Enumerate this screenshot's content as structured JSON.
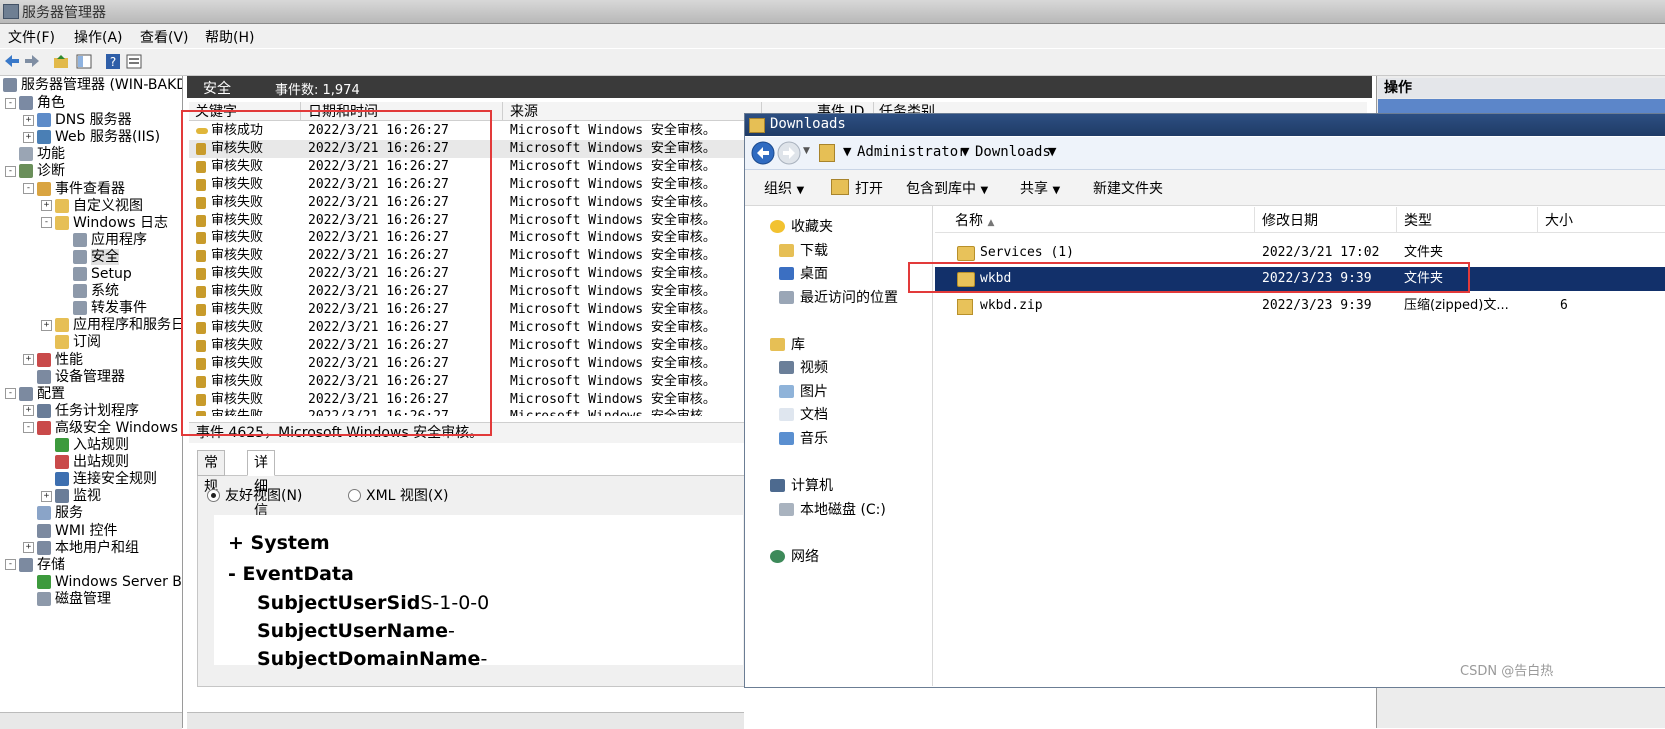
{
  "window": {
    "title": "服务器管理器"
  },
  "menu": [
    "文件(F)",
    "操作(A)",
    "查看(V)",
    "帮助(H)"
  ],
  "tree": {
    "root": "服务器管理器 (WIN-BAKD",
    "nodes": [
      {
        "label": "角色",
        "indent": 1
      },
      {
        "label": "DNS 服务器",
        "indent": 2
      },
      {
        "label": "Web 服务器(IIS)",
        "indent": 2
      },
      {
        "label": "功能",
        "indent": 1
      },
      {
        "label": "诊断",
        "indent": 1
      },
      {
        "label": "事件查看器",
        "indent": 2
      },
      {
        "label": "自定义视图",
        "indent": 3
      },
      {
        "label": "Windows 日志",
        "indent": 3
      },
      {
        "label": "应用程序",
        "indent": 4
      },
      {
        "label": "安全",
        "indent": 4
      },
      {
        "label": "Setup",
        "indent": 4
      },
      {
        "label": "系统",
        "indent": 4
      },
      {
        "label": "转发事件",
        "indent": 4
      },
      {
        "label": "应用程序和服务日",
        "indent": 3
      },
      {
        "label": "订阅",
        "indent": 3
      },
      {
        "label": "性能",
        "indent": 2
      },
      {
        "label": "设备管理器",
        "indent": 2
      },
      {
        "label": "配置",
        "indent": 1
      },
      {
        "label": "任务计划程序",
        "indent": 2
      },
      {
        "label": "高级安全 Windows",
        "indent": 2
      },
      {
        "label": "入站规则",
        "indent": 3
      },
      {
        "label": "出站规则",
        "indent": 3
      },
      {
        "label": "连接安全规则",
        "indent": 3
      },
      {
        "label": "监视",
        "indent": 3
      },
      {
        "label": "服务",
        "indent": 2
      },
      {
        "label": "WMI 控件",
        "indent": 2
      },
      {
        "label": "本地用户和组",
        "indent": 2
      },
      {
        "label": "存储",
        "indent": 1
      },
      {
        "label": "Windows Server Ba",
        "indent": 2
      },
      {
        "label": "磁盘管理",
        "indent": 2
      }
    ]
  },
  "log": {
    "name": "安全",
    "count_label": "事件数: 1,974",
    "columns": [
      "关键字",
      "日期和时间",
      "来源",
      "事件 ID",
      "任务类别"
    ],
    "rows": [
      {
        "keyword": "审核成功",
        "datetime": "2022/3/21 16:26:27",
        "source": "Microsoft Windows 安全审核。"
      },
      {
        "keyword": "审核失败",
        "datetime": "2022/3/21 16:26:27",
        "source": "Microsoft Windows 安全审核。"
      },
      {
        "keyword": "审核失败",
        "datetime": "2022/3/21 16:26:27",
        "source": "Microsoft Windows 安全审核。"
      },
      {
        "keyword": "审核失败",
        "datetime": "2022/3/21 16:26:27",
        "source": "Microsoft Windows 安全审核。"
      },
      {
        "keyword": "审核失败",
        "datetime": "2022/3/21 16:26:27",
        "source": "Microsoft Windows 安全审核。"
      },
      {
        "keyword": "审核失败",
        "datetime": "2022/3/21 16:26:27",
        "source": "Microsoft Windows 安全审核。"
      },
      {
        "keyword": "审核失败",
        "datetime": "2022/3/21 16:26:27",
        "source": "Microsoft Windows 安全审核。"
      },
      {
        "keyword": "审核失败",
        "datetime": "2022/3/21 16:26:27",
        "source": "Microsoft Windows 安全审核。"
      },
      {
        "keyword": "审核失败",
        "datetime": "2022/3/21 16:26:27",
        "source": "Microsoft Windows 安全审核。"
      },
      {
        "keyword": "审核失败",
        "datetime": "2022/3/21 16:26:27",
        "source": "Microsoft Windows 安全审核。"
      },
      {
        "keyword": "审核失败",
        "datetime": "2022/3/21 16:26:27",
        "source": "Microsoft Windows 安全审核。"
      },
      {
        "keyword": "审核失败",
        "datetime": "2022/3/21 16:26:27",
        "source": "Microsoft Windows 安全审核。"
      },
      {
        "keyword": "审核失败",
        "datetime": "2022/3/21 16:26:27",
        "source": "Microsoft Windows 安全审核。"
      },
      {
        "keyword": "审核失败",
        "datetime": "2022/3/21 16:26:27",
        "source": "Microsoft Windows 安全审核。"
      },
      {
        "keyword": "审核失败",
        "datetime": "2022/3/21 16:26:27",
        "source": "Microsoft Windows 安全审核。"
      },
      {
        "keyword": "审核失败",
        "datetime": "2022/3/21 16:26:27",
        "source": "Microsoft Windows 安全审核。"
      },
      {
        "keyword": "审核失败",
        "datetime": "2022/3/21 16:26:27",
        "source": "Microsoft Windows 安全审核。"
      }
    ],
    "status": "事件 4625，Microsoft Windows 安全审核。",
    "tabs": [
      "常规",
      "详细信息"
    ],
    "view_options": [
      "友好视图(N)",
      "XML 视图(X)"
    ],
    "detail": {
      "system": "+ System",
      "eventdata": "-  EventData",
      "fields": [
        {
          "name": "SubjectUserSid",
          "value": "S-1-0-0"
        },
        {
          "name": "SubjectUserName",
          "value": "-"
        },
        {
          "name": "SubjectDomainName",
          "value": "-"
        }
      ]
    }
  },
  "actions": {
    "title": "操作"
  },
  "explorer": {
    "title": "Downloads",
    "path": [
      "Administrator",
      "Downloads"
    ],
    "commands": [
      "组织",
      "打开",
      "包含到库中",
      "共享",
      "新建文件夹"
    ],
    "nav": {
      "favorites": "收藏夹",
      "fav_items": [
        "下载",
        "桌面",
        "最近访问的位置"
      ],
      "libraries": "库",
      "lib_items": [
        "视频",
        "图片",
        "文档",
        "音乐"
      ],
      "computer": "计算机",
      "computer_items": [
        "本地磁盘 (C:)"
      ],
      "network": "网络"
    },
    "columns": [
      "名称",
      "修改日期",
      "类型",
      "大小"
    ],
    "files": [
      {
        "name": "Services (1)",
        "date": "2022/3/21 17:02",
        "type": "文件夹",
        "size": "",
        "kind": "folder"
      },
      {
        "name": "wkbd",
        "date": "2022/3/23 9:39",
        "type": "文件夹",
        "size": "",
        "kind": "folder"
      },
      {
        "name": "wkbd.zip",
        "date": "2022/3/23 9:39",
        "type": "压缩(zipped)文...",
        "size": "6",
        "kind": "zip"
      }
    ]
  },
  "watermark": "CSDN @告白热"
}
